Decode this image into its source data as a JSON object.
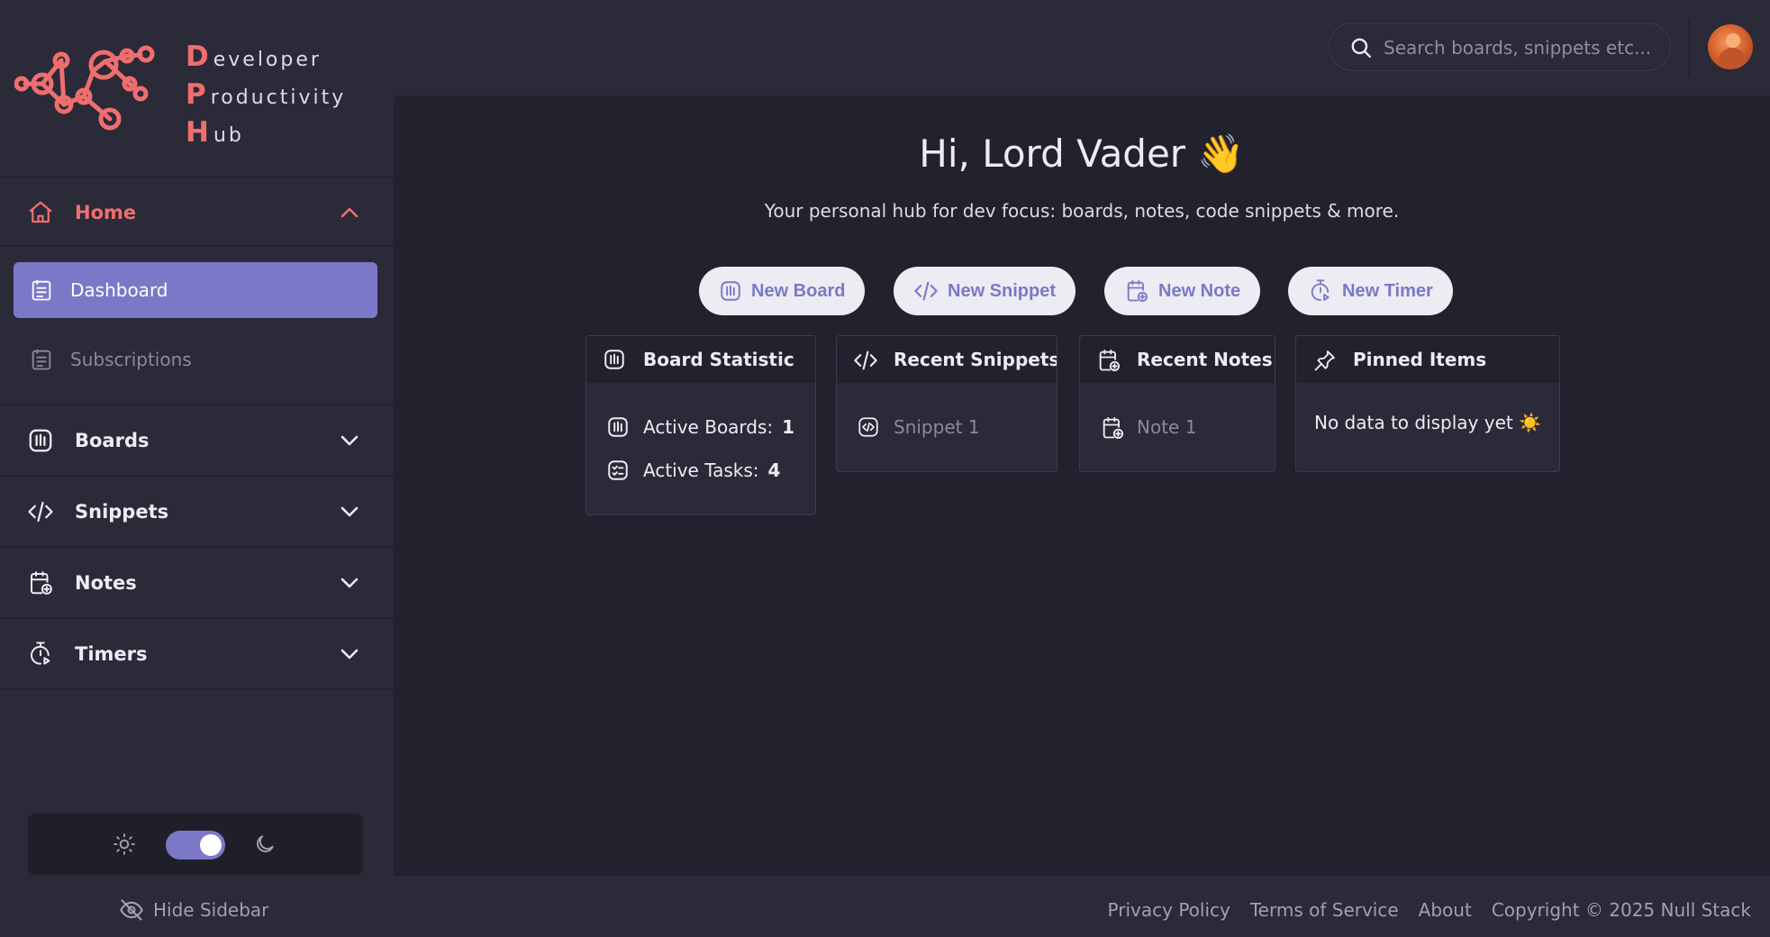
{
  "brand": {
    "lines": [
      {
        "initial": "D",
        "rest": "eveloper"
      },
      {
        "initial": "P",
        "rest": "roductivity"
      },
      {
        "initial": "H",
        "rest": "ub"
      }
    ]
  },
  "search": {
    "placeholder": "Search boards, snippets etc..."
  },
  "sidebar": {
    "home": {
      "label": "Home",
      "items": [
        {
          "label": "Dashboard"
        },
        {
          "label": "Subscriptions"
        }
      ]
    },
    "sections": [
      {
        "label": "Boards"
      },
      {
        "label": "Snippets"
      },
      {
        "label": "Notes"
      },
      {
        "label": "Timers"
      }
    ],
    "hide_label": "Hide Sidebar"
  },
  "main": {
    "greeting": "Hi, Lord Vader 👋",
    "tagline": "Your personal hub for dev focus: boards, notes, code snippets & more.",
    "quick_actions": [
      {
        "label": "New Board"
      },
      {
        "label": "New Snippet"
      },
      {
        "label": "New Note"
      },
      {
        "label": "New Timer"
      }
    ],
    "cards": {
      "board_statistic": {
        "title": "Board Statistic",
        "active_boards_label": "Active Boards:",
        "active_boards": "1",
        "active_tasks_label": "Active Tasks:",
        "active_tasks": "4"
      },
      "recent_snippets": {
        "title": "Recent Snippets",
        "items": [
          {
            "label": "Snippet 1"
          }
        ]
      },
      "recent_notes": {
        "title": "Recent Notes",
        "items": [
          {
            "label": "Note 1"
          }
        ]
      },
      "pinned_items": {
        "title": "Pinned Items",
        "empty": "No data to display yet ☀️"
      }
    }
  },
  "footer": {
    "links": [
      {
        "label": "Privacy Policy"
      },
      {
        "label": "Terms of Service"
      },
      {
        "label": "About"
      }
    ],
    "copyright": "Copyright © 2025 Null Stack"
  },
  "colors": {
    "accent": "#f06e6e",
    "primary": "#7b78c8",
    "background": "#2a2a38",
    "panel": "#22222e"
  },
  "theme": {
    "mode": "dark"
  }
}
